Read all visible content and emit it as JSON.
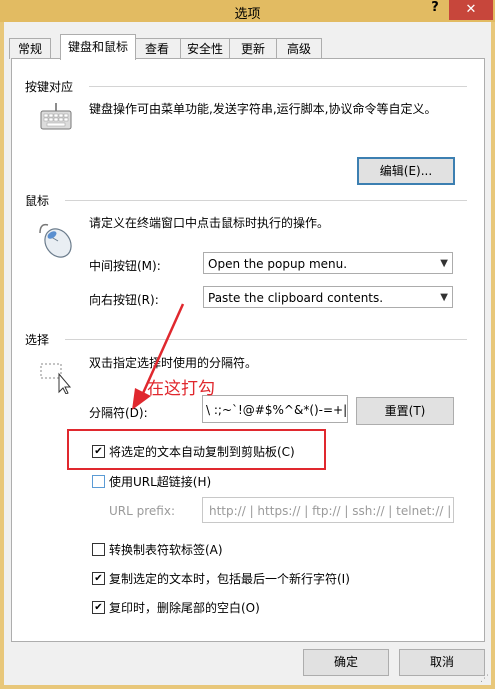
{
  "window": {
    "title": "选项",
    "help": "?",
    "close": "✕"
  },
  "tabs": [
    {
      "label": "常规"
    },
    {
      "label": "键盘和鼠标"
    },
    {
      "label": "查看"
    },
    {
      "label": "安全性"
    },
    {
      "label": "更新"
    },
    {
      "label": "高级"
    }
  ],
  "keymap": {
    "heading": "按键对应",
    "description": "键盘操作可由菜单功能,发送字符串,运行脚本,协议命令等自定义。",
    "edit_button": "编辑(E)..."
  },
  "mouse": {
    "heading": "鼠标",
    "description": "请定义在终端窗口中点击鼠标时执行的操作。",
    "middle_label": "中间按钮(M):",
    "middle_value": "Open the popup menu.",
    "right_label": "向右按钮(R):",
    "right_value": "Paste the clipboard contents."
  },
  "selection": {
    "heading": "选择",
    "description": "双击指定选择时使用的分隔符。",
    "delimiter_label": "分隔符(D):",
    "delimiter_value": "\\ :;~`!@#$%^&*()-=+|[{",
    "reset_button": "重置(T)",
    "copy_on_select": {
      "label": "将选定的文本自动复制到剪贴板(C)",
      "checked": true
    },
    "use_url_hyperlink": {
      "label": "使用URL超链接(H)",
      "checked": false
    },
    "url_prefix_label": "URL prefix:",
    "url_prefix_value": "http:// | https:// | ftp:// | ssh:// | telnet:// |",
    "convert_tabs": {
      "label": "转换制表符软标签(A)",
      "checked": false
    },
    "copy_include_newline": {
      "label": "复制选定的文本时，包括最后一个新行字符(I)",
      "checked": true
    },
    "trim_trailing_spaces": {
      "label": "复印时，删除尾部的空白(O)",
      "checked": true
    }
  },
  "annotation": {
    "text": "在这打勾",
    "color": "#e0282e"
  },
  "footer": {
    "ok_button": "确定",
    "cancel_button": "取消"
  }
}
